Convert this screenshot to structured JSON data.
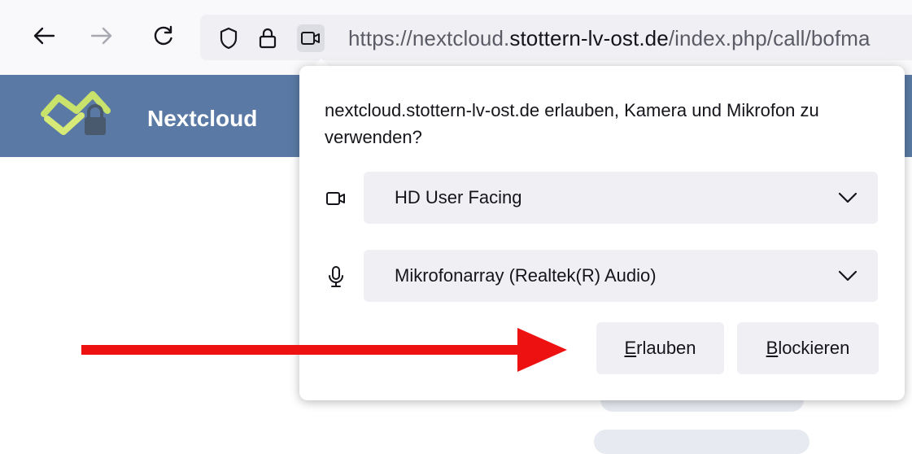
{
  "browser": {
    "url_prefix": "https://nextcloud.",
    "url_domain": "stottern-lv-ost.de",
    "url_suffix": "/index.php/call/bofma",
    "icons": {
      "back": "arrow-left-icon",
      "forward": "arrow-right-icon",
      "reload": "reload-icon",
      "tracking_protection": "shield-icon",
      "secure": "lock-icon",
      "camera_permission": "camera-icon"
    }
  },
  "nextcloud": {
    "app_name": "Nextcloud",
    "header_color": "#5a7aa5"
  },
  "permission_panel": {
    "message": "nextcloud.stottern-lv-ost.de erlauben, Kamera und Mikrofon zu verwenden?",
    "camera_select": {
      "selected": "HD User Facing",
      "icon": "camera-icon"
    },
    "microphone_select": {
      "selected": "Mikrofonarray (Realtek(R) Audio)",
      "icon": "microphone-icon"
    },
    "allow_button": {
      "access_key": "E",
      "rest": "rlauben"
    },
    "block_button": {
      "access_key": "B",
      "rest": "lockieren"
    }
  },
  "annotation": {
    "type": "red-arrow",
    "color": "#ee1111",
    "points_to": "allow_button"
  }
}
